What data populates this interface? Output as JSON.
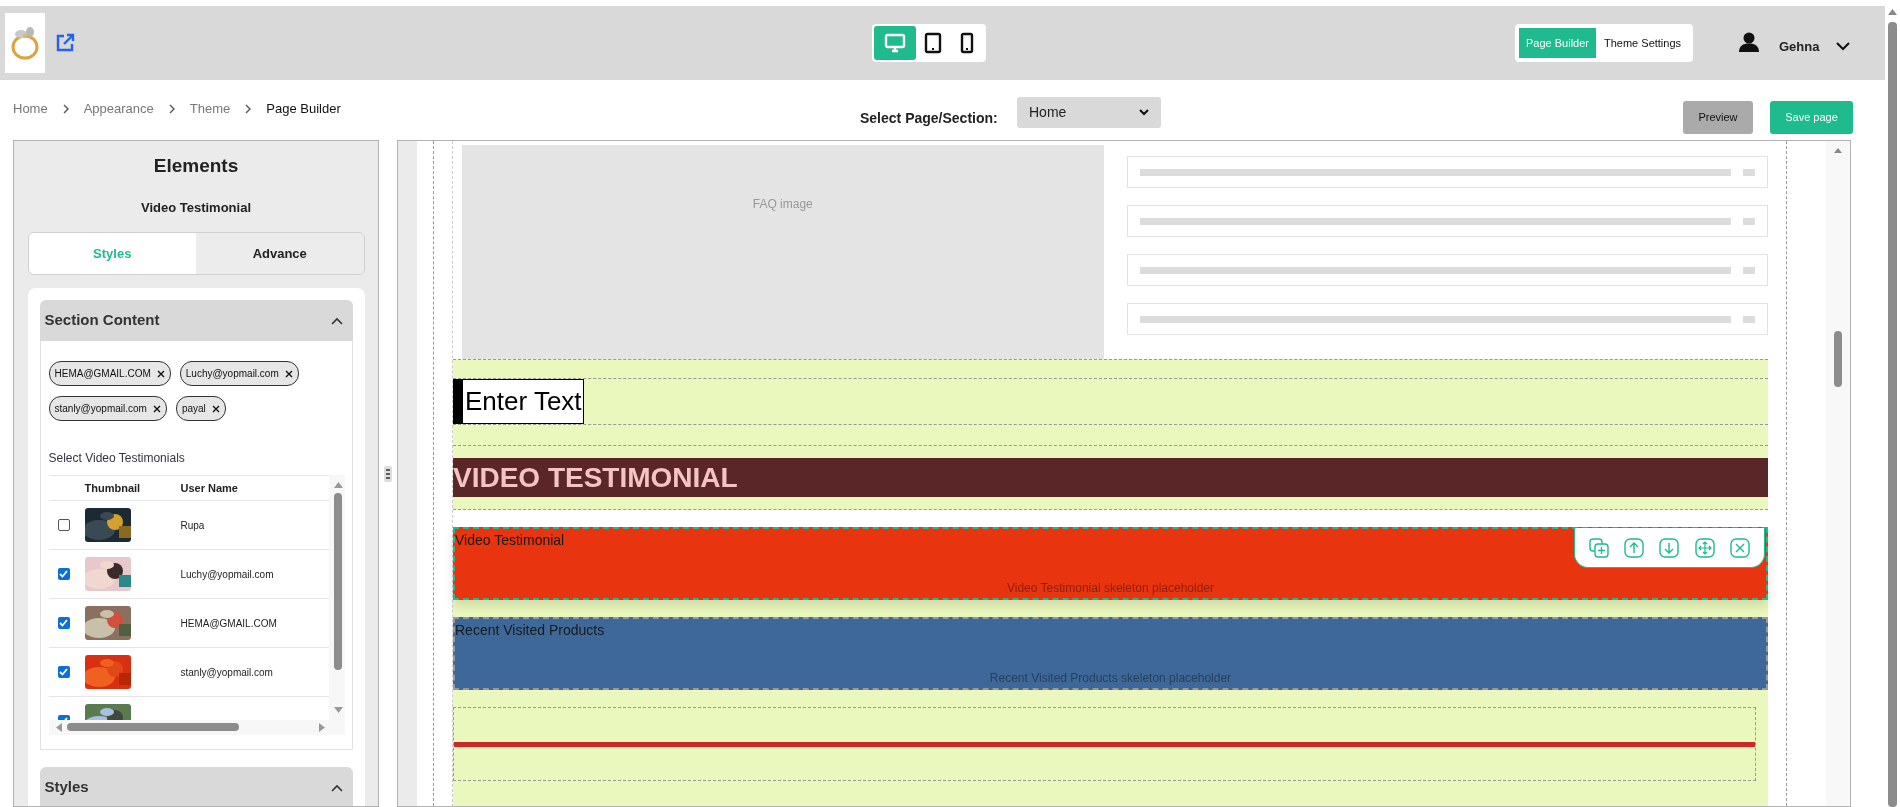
{
  "header": {
    "device_modes": [
      {
        "kind": "desktop",
        "selected": true
      },
      {
        "kind": "tablet",
        "selected": false
      },
      {
        "kind": "mobile",
        "selected": false
      }
    ],
    "mode_tabs": [
      {
        "label": "Page Builder",
        "selected": true
      },
      {
        "label": "Theme Settings",
        "selected": false
      }
    ],
    "user": {
      "name": "Gehna"
    }
  },
  "breadcrumb": [
    "Home",
    "Appearance",
    "Theme",
    "Page Builder"
  ],
  "page_select": {
    "label": "Select Page/Section:",
    "value": "Home"
  },
  "actions": [
    {
      "label": "Preview",
      "kind": "secondary"
    },
    {
      "label": "Save page",
      "kind": "primary"
    }
  ],
  "sidebar": {
    "title": "Elements",
    "subtitle": "Video Testimonial",
    "tabs": [
      {
        "label": "Styles",
        "selected": true
      },
      {
        "label": "Advance",
        "selected": false
      }
    ],
    "section_content": {
      "title": "Section Content",
      "expanded": true,
      "chips": [
        "HEMA@GMAIL.COM",
        "Luchy@yopmail.com",
        "stanly@yopmail.com",
        "payal"
      ],
      "list_label": "Select Video Testimonials",
      "columns": [
        "Thumbnail",
        "User Name"
      ],
      "rows": [
        {
          "checked": false,
          "user_name": "Rupa"
        },
        {
          "checked": true,
          "user_name": "Luchy@yopmail.com"
        },
        {
          "checked": true,
          "user_name": "HEMA@GMAIL.COM"
        },
        {
          "checked": true,
          "user_name": "stanly@yopmail.com"
        },
        {
          "checked": true
        }
      ]
    },
    "styles": {
      "title": "Styles",
      "expanded": true
    }
  },
  "canvas": {
    "sections": [
      {
        "kind": "faq",
        "image_label": "FAQ image",
        "items": [
          {
            "kind": "skeleton"
          },
          {
            "kind": "skeleton"
          },
          {
            "kind": "skeleton"
          },
          {
            "kind": "skeleton"
          }
        ]
      },
      {
        "kind": "text",
        "text": "Enter Text"
      },
      {
        "kind": "heading",
        "text": "VIDEO TESTIMONIAL",
        "color": "#5a2627"
      },
      {
        "kind": "block",
        "title": "Video Testimonial",
        "placeholder": "Video Testimonial skeleton placeholder",
        "color": "#e8340f",
        "selected": true
      },
      {
        "kind": "block",
        "title": "Recent Visited Products",
        "placeholder": "Recent Visited Products skeleton placeholder",
        "color": "#3d6899",
        "selected": false
      },
      {
        "kind": "divider",
        "color": "#cc2a2a"
      }
    ]
  }
}
